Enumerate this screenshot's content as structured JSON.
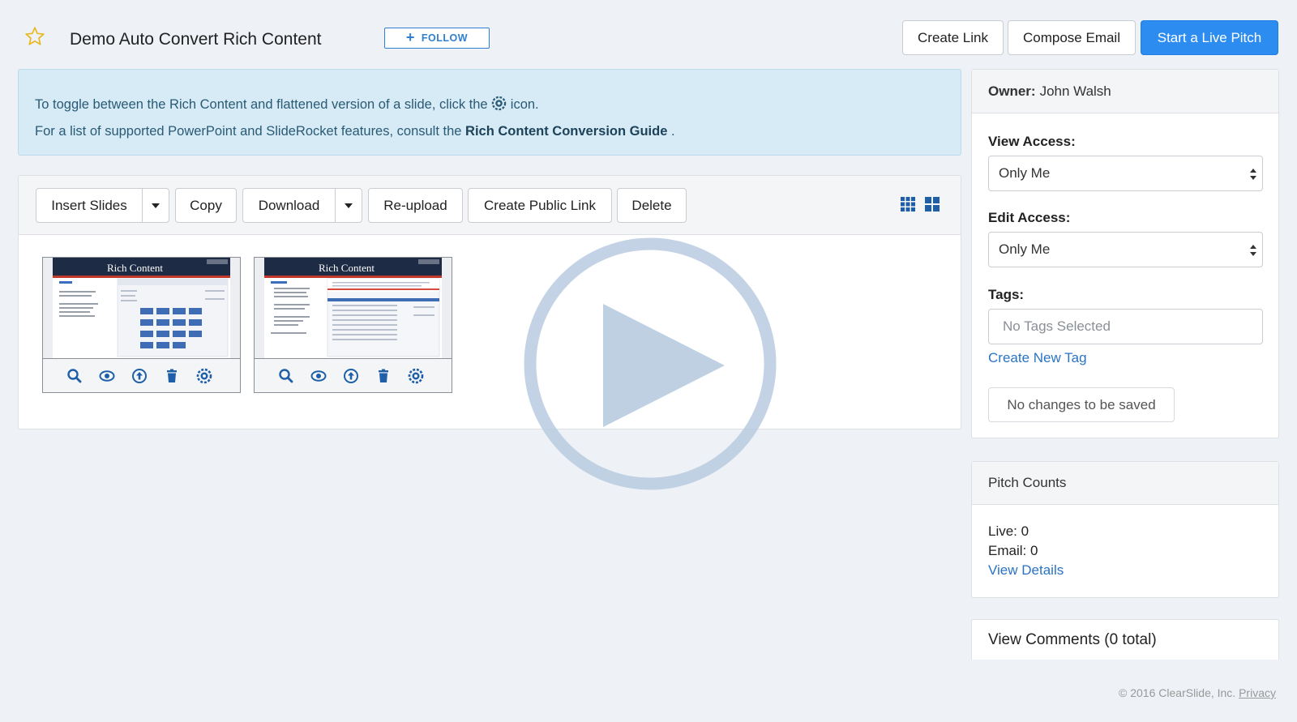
{
  "header": {
    "title": "Demo Auto Convert Rich Content",
    "follow_label": "FOLLOW",
    "create_link": "Create Link",
    "compose_email": "Compose Email",
    "start_live_pitch": "Start a Live Pitch"
  },
  "alert": {
    "line1_pre": "To toggle between the Rich Content and flattened version of a slide, click the",
    "line1_post": "icon.",
    "line2_pre": "For a list of supported PowerPoint and SlideRocket features, consult the",
    "line2_link": "Rich Content Conversion Guide",
    "line2_post": "."
  },
  "toolbar": {
    "insert_slides": "Insert Slides",
    "copy": "Copy",
    "download": "Download",
    "reupload": "Re-upload",
    "create_public_link": "Create Public Link",
    "delete": "Delete"
  },
  "slides": [
    {
      "title": "Rich Content"
    },
    {
      "title": "Rich Content"
    }
  ],
  "sidebar": {
    "owner_label": "Owner:",
    "owner_name": "John Walsh",
    "view_access_label": "View Access:",
    "view_access_value": "Only Me",
    "edit_access_label": "Edit Access:",
    "edit_access_value": "Only Me",
    "tags_label": "Tags:",
    "tags_placeholder": "No Tags Selected",
    "create_new_tag": "Create New Tag",
    "save_status": "No changes to be saved"
  },
  "pitch_counts": {
    "title": "Pitch Counts",
    "live": "Live: 0",
    "email": "Email: 0",
    "view_details": "View Details"
  },
  "comments": {
    "title": "View Comments (0 total)"
  },
  "footer": {
    "copyright": "© 2016 ClearSlide, Inc.",
    "privacy": "Privacy"
  },
  "colors": {
    "accent": "#2d8cf0",
    "link": "#2a73c5",
    "alert_bg": "#d6ebf5",
    "icon": "#1f5fa8",
    "star": "#e8b923"
  }
}
